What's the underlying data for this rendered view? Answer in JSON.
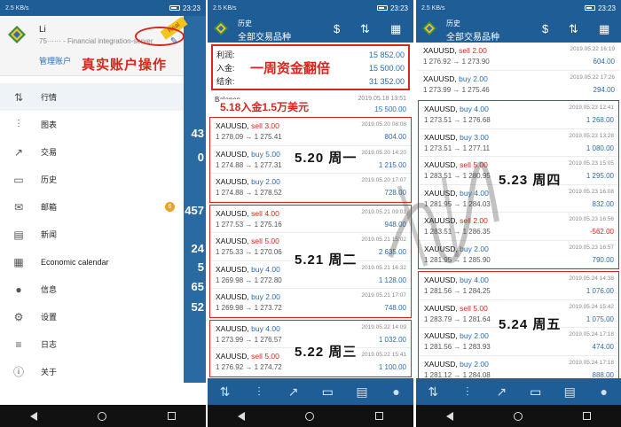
{
  "status": {
    "time": "23:23",
    "left_small": "2.5 KB/s"
  },
  "drawer": {
    "account_name": "Li",
    "account_sub": "75······ - Financial integration-server",
    "manage_label": "管理账户",
    "title_red": "真实账户操作",
    "ribbon": "Real",
    "menu": [
      {
        "label": "行情",
        "icon": "chart-up-icon",
        "glyph": "⇅"
      },
      {
        "label": "图表",
        "icon": "candles-icon",
        "glyph": "⫶"
      },
      {
        "label": "交易",
        "icon": "trend-icon",
        "glyph": "↗"
      },
      {
        "label": "历史",
        "icon": "inbox-icon",
        "glyph": "▭"
      },
      {
        "label": "邮箱",
        "icon": "mail-icon",
        "glyph": "✉",
        "badge": "6"
      },
      {
        "label": "新闻",
        "icon": "news-icon",
        "glyph": "▤"
      },
      {
        "label": "Economic calendar",
        "icon": "calendar-icon",
        "glyph": "▦"
      },
      {
        "label": "信息",
        "icon": "chat-icon",
        "glyph": "●"
      },
      {
        "label": "设置",
        "icon": "gear-icon",
        "glyph": "⚙"
      },
      {
        "label": "日志",
        "icon": "log-icon",
        "glyph": "≡"
      },
      {
        "label": "关于",
        "icon": "about-icon",
        "glyph": "ⓘ"
      }
    ],
    "bg_numbers": [
      "43",
      "0",
      "457",
      "24",
      "5",
      "65",
      "52"
    ]
  },
  "history": {
    "title_small": "历史",
    "title_main": "全部交易品种",
    "summary": {
      "profit_label": "利润:",
      "profit_value": "15 852.00",
      "deposit_label": "入金:",
      "deposit_value": "15 500.00",
      "balance_label": "结余:",
      "balance_value": "31 352.00",
      "overlay": "一周资金翻倍"
    },
    "balance_row": {
      "label": "Balance",
      "date": "2019.05.18 13:51",
      "amount": "15 500.00",
      "overlay": "5.18入金1.5万美元"
    }
  },
  "days_p2": [
    {
      "label": "5.20 周一",
      "trades": [
        {
          "sym": "XAUUSD,",
          "side": "sell",
          "lot": "3.00",
          "prices": "1 278.09 → 1 275.41",
          "date": "2019.05.20 08:08",
          "profit": "804.00"
        },
        {
          "sym": "XAUUSD,",
          "side": "buy",
          "lot": "5.00",
          "prices": "1 274.88 → 1 277.31",
          "date": "2019.05.20 14:20",
          "profit": "1 215.00"
        },
        {
          "sym": "XAUUSD,",
          "side": "buy",
          "lot": "2.00",
          "prices": "1 274.88 → 1 278.52",
          "date": "2019.05.20 17:07",
          "profit": "728.00"
        }
      ]
    },
    {
      "label": "5.21 周二",
      "trades": [
        {
          "sym": "XAUUSD,",
          "side": "sell",
          "lot": "4.00",
          "prices": "1 277.53 → 1 275.16",
          "date": "2019.05.21 09:01",
          "profit": "948.00"
        },
        {
          "sym": "XAUUSD,",
          "side": "sell",
          "lot": "5.00",
          "prices": "1 275.33 → 1 270.06",
          "date": "2019.05.21 15:02",
          "profit": "2 635.00"
        },
        {
          "sym": "XAUUSD,",
          "side": "buy",
          "lot": "4.00",
          "prices": "1 269.98 → 1 272.80",
          "date": "2019.05.21 16:32",
          "profit": "1 128.00"
        },
        {
          "sym": "XAUUSD,",
          "side": "buy",
          "lot": "2.00",
          "prices": "1 269.98 → 1 273.72",
          "date": "2019.05.21 17:07",
          "profit": "748.00"
        }
      ]
    },
    {
      "label": "5.22 周三",
      "trades": [
        {
          "sym": "XAUUSD,",
          "side": "buy",
          "lot": "4.00",
          "prices": "1 273.99 → 1 276.57",
          "date": "2019.05.22 14:09",
          "profit": "1 032.00"
        },
        {
          "sym": "XAUUSD,",
          "side": "sell",
          "lot": "5.00",
          "prices": "1 276.92 → 1 274.72",
          "date": "2019.05.22 15:41",
          "profit": "1 100.00"
        }
      ]
    }
  ],
  "p3_top": [
    {
      "sym": "XAUUSD,",
      "side": "sell",
      "lot": "2.00",
      "prices": "1 276.92 → 1 273.90",
      "date": "2019.05.22 16:19",
      "profit": "604.00"
    },
    {
      "sym": "XAUUSD,",
      "side": "buy",
      "lot": "2.00",
      "prices": "1 273.99 → 1 275.46",
      "date": "2019.05.22 17:26",
      "profit": "294.00"
    }
  ],
  "days_p3": [
    {
      "label": "5.23 周四",
      "trades": [
        {
          "sym": "XAUUSD,",
          "side": "buy",
          "lot": "4.00",
          "prices": "1 273.51 → 1 276.68",
          "date": "2019.05.23 12:41",
          "profit": "1 268.00"
        },
        {
          "sym": "XAUUSD,",
          "side": "buy",
          "lot": "3.00",
          "prices": "1 273.51 → 1 277.11",
          "date": "2019.05.23 13:28",
          "profit": "1 080.00"
        },
        {
          "sym": "XAUUSD,",
          "side": "sell",
          "lot": "5.00",
          "prices": "1 283.51 → 1 280.95",
          "date": "2019.05.23 15:05",
          "profit": "1 295.00"
        },
        {
          "sym": "XAUUSD,",
          "side": "buy",
          "lot": "4.00",
          "prices": "1 281.95 → 1 284.03",
          "date": "2019.05.23 16:08",
          "profit": "832.00"
        },
        {
          "sym": "XAUUSD,",
          "side": "sell",
          "lot": "2.00",
          "prices": "1 283.51 → 1 286.35",
          "date": "2019.05.23 16:56",
          "profit": "-562.00"
        },
        {
          "sym": "XAUUSD,",
          "side": "buy",
          "lot": "2.00",
          "prices": "1 281.95 → 1 285.90",
          "date": "2019.05.23 16:57",
          "profit": "790.00"
        }
      ]
    },
    {
      "label": "5.24 周五",
      "trades": [
        {
          "sym": "XAUUSD,",
          "side": "buy",
          "lot": "4.00",
          "prices": "1 281.56 → 1 284.25",
          "date": "2019.05.24 14:38",
          "profit": "1 076.00"
        },
        {
          "sym": "XAUUSD,",
          "side": "sell",
          "lot": "5.00",
          "prices": "1 283.79 → 1 281.64",
          "date": "2019.05.24 15:42",
          "profit": "1 075.00"
        },
        {
          "sym": "XAUUSD,",
          "side": "buy",
          "lot": "2.00",
          "prices": "1 281.56 → 1 283.93",
          "date": "2019.05.24 17:18",
          "profit": "474.00"
        },
        {
          "sym": "XAUUSD,",
          "side": "buy",
          "lot": "2.00",
          "prices": "1 281.12 → 1 284.08",
          "date": "2019.05.24 17:18",
          "profit": "888.00"
        }
      ]
    }
  ],
  "colors": {
    "brand": "#1e5d96",
    "buy": "#2b6db0",
    "sell": "#d9261c",
    "highlight": "#d9261c"
  }
}
